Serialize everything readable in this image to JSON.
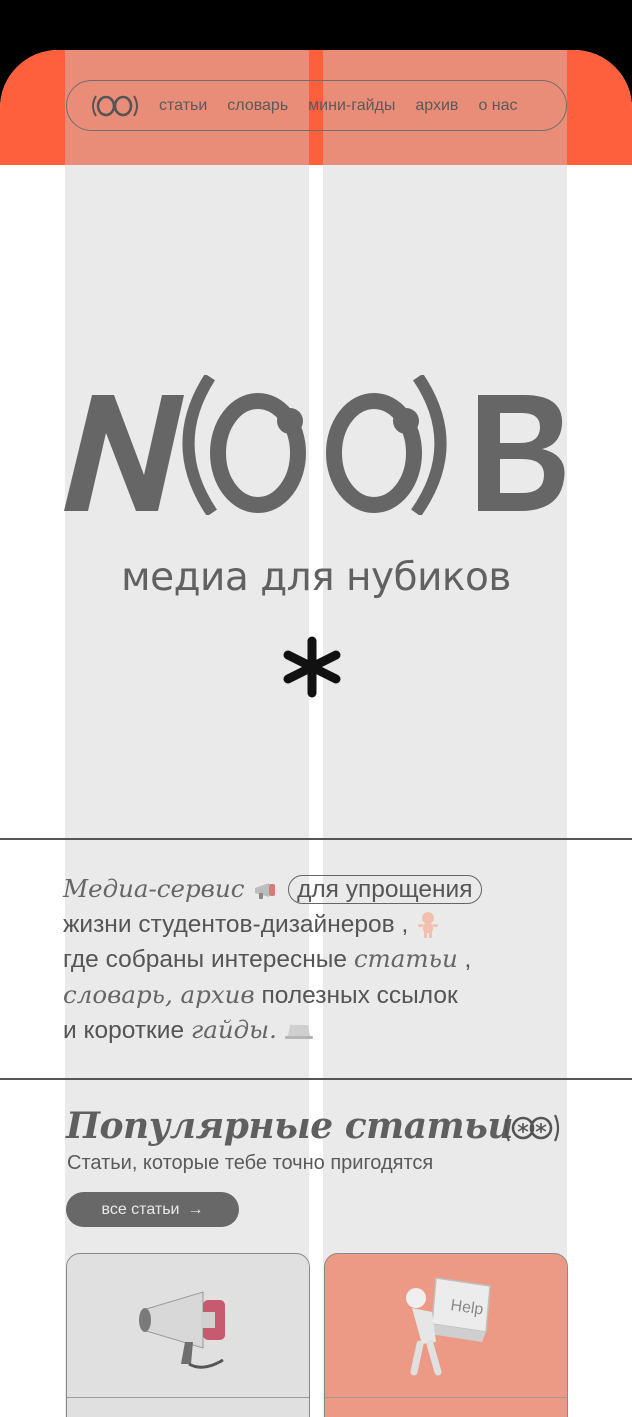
{
  "nav": {
    "logo": "(OO)",
    "links": [
      "статьи",
      "словарь",
      "мини-гайды",
      "архив",
      "о нас"
    ]
  },
  "hero": {
    "logo_text": "N(OO)B",
    "tagline": "медиа для нубиков"
  },
  "intro": {
    "w1": "Медиа-сервис",
    "pill": "для упрощения",
    "w2": "жизни  студентов-дизайнеров ,",
    "w3": "где собраны интересные",
    "w4": "статьи",
    "w5": ",",
    "w6": "словарь, архив",
    "w7": "полезных ссылок",
    "w8": "и короткие",
    "w9": "гайды."
  },
  "popular": {
    "title": "Популярные статьи",
    "subtitle": "Статьи, которые тебе точно пригодятся",
    "all_button": "все статьи",
    "arrow": "→",
    "cards": [
      {
        "image": "megaphone-icon"
      },
      {
        "image": "help-key-figure",
        "key_label": "Help"
      }
    ]
  },
  "colors": {
    "accent": "#fe5f3d",
    "card_accent": "#ec9a85",
    "text": "#5a5a5a"
  }
}
